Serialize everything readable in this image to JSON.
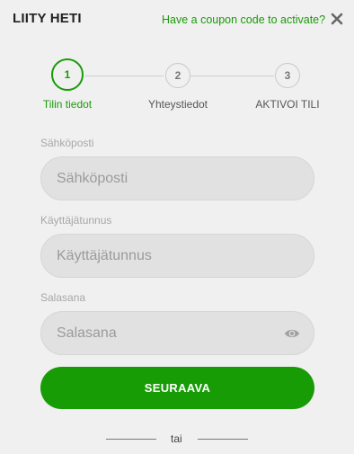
{
  "header": {
    "title": "LIITY HETI",
    "coupon_link": "Have a coupon code to activate?",
    "close_icon": "close-icon"
  },
  "stepper": {
    "steps": [
      {
        "number": "1",
        "label": "Tilin tiedot",
        "state": "active"
      },
      {
        "number": "2",
        "label": "Yhteystiedot",
        "state": "inactive"
      },
      {
        "number": "3",
        "label": "AKTIVOI TILI",
        "state": "inactive"
      }
    ]
  },
  "form": {
    "email": {
      "label": "Sähköposti",
      "placeholder": "Sähköposti",
      "value": ""
    },
    "username": {
      "label": "Käyttäjätunnus",
      "placeholder": "Käyttäjätunnus",
      "value": ""
    },
    "password": {
      "label": "Salasana",
      "placeholder": "Salasana",
      "value": "",
      "toggle_icon": "eye-icon"
    },
    "submit_label": "SEURAAVA"
  },
  "divider": {
    "text": "tai"
  },
  "colors": {
    "accent": "#179c06",
    "background": "#f1f0f0",
    "input_background": "#e1e1e1",
    "label": "#a7a7a7"
  }
}
